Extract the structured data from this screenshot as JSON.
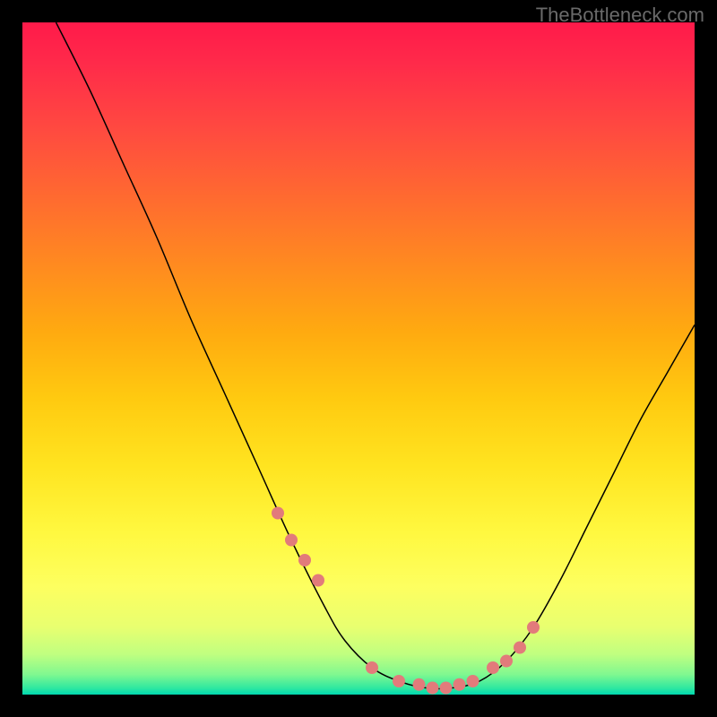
{
  "watermark": "TheBottleneck.com",
  "chart_data": {
    "type": "line",
    "title": "",
    "xlabel": "",
    "ylabel": "",
    "xlim": [
      0,
      100
    ],
    "ylim": [
      0,
      100
    ],
    "grid": false,
    "series": [
      {
        "name": "curve",
        "x": [
          5,
          10,
          15,
          20,
          25,
          30,
          35,
          40,
          45,
          48,
          52,
          56,
          60,
          64,
          68,
          72,
          76,
          80,
          84,
          88,
          92,
          96,
          100
        ],
        "y": [
          100,
          90,
          79,
          68,
          56,
          45,
          34,
          23,
          13,
          8,
          4,
          2,
          1,
          1,
          2,
          5,
          10,
          17,
          25,
          33,
          41,
          48,
          55
        ]
      }
    ],
    "highlight_points": {
      "x": [
        38,
        40,
        42,
        44,
        52,
        56,
        59,
        61,
        63,
        65,
        67,
        70,
        72,
        74,
        76
      ],
      "y": [
        27,
        23,
        20,
        17,
        4,
        2,
        1.5,
        1,
        1,
        1.5,
        2,
        4,
        5,
        7,
        10
      ]
    },
    "gradient_description": "vertical red-to-green heatmap background"
  }
}
